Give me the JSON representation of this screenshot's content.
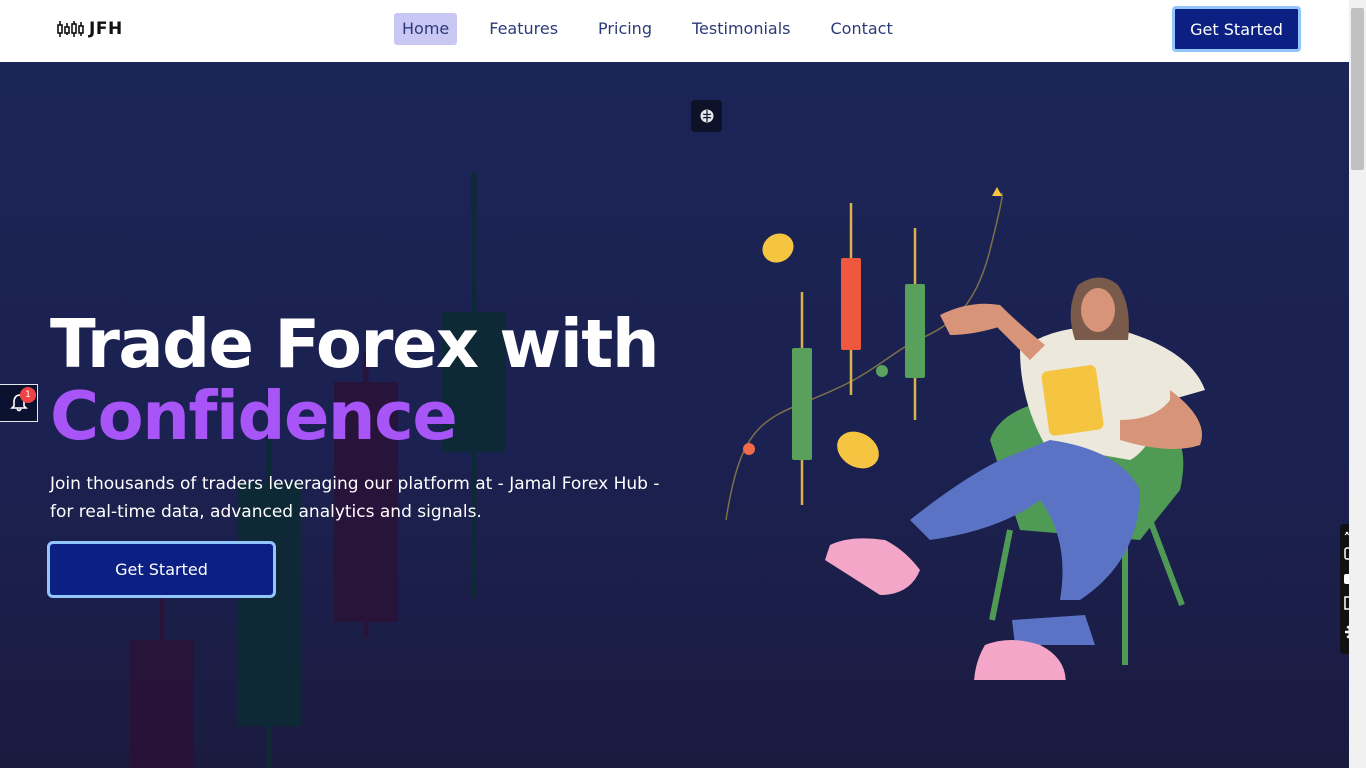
{
  "brand": {
    "name": "JFH"
  },
  "nav": {
    "links": [
      {
        "label": "Home",
        "active": true
      },
      {
        "label": "Features"
      },
      {
        "label": "Pricing"
      },
      {
        "label": "Testimonials"
      },
      {
        "label": "Contact"
      }
    ],
    "cta_label": "Get Started"
  },
  "hero": {
    "title_line1": "Trade Forex with",
    "title_accent": "Confidence",
    "subtitle": "Join thousands of traders leveraging our platform at - Jamal Forex Hub - for real-time data, advanced analytics and signals.",
    "cta_label": "Get Started"
  },
  "notification": {
    "count": "1"
  },
  "colors": {
    "accent": "#a855f7",
    "button": "#0c1f82",
    "button_border": "#93c5fd",
    "hero_bg": "#1b2556",
    "nav_active_bg": "#c9c8f4"
  },
  "icons": [
    "logo-candles-icon",
    "brain-icon",
    "bell-icon",
    "camera-icon",
    "video-icon",
    "copy-icon",
    "gear-icon",
    "link-icon",
    "more-icon"
  ]
}
